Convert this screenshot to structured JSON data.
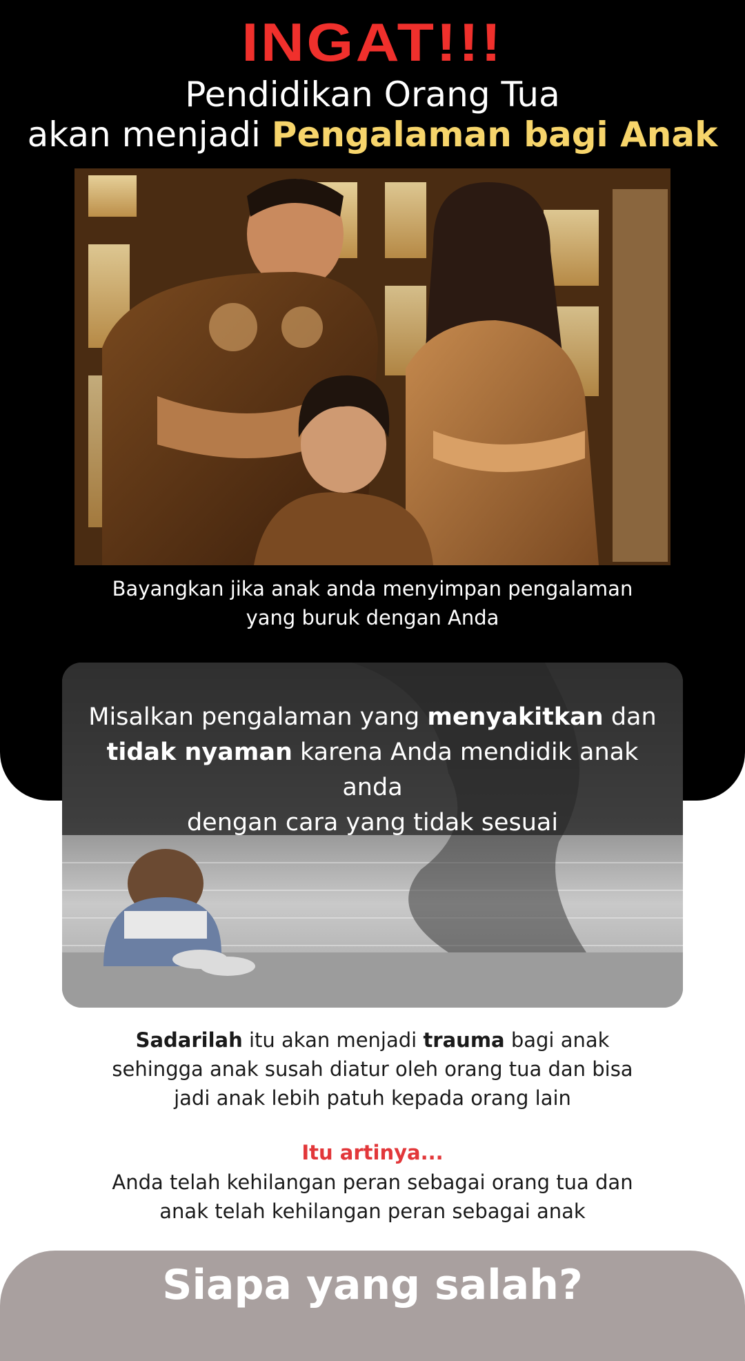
{
  "hero": {
    "title": "INGAT!!!",
    "headline_line1": "Pendidikan Orang Tua",
    "headline_line2_prefix": "akan menjadi ",
    "headline_line2_highlight": "Pengalaman bagi Anak",
    "caption_line1": "Bayangkan jika anak anda menyimpan pengalaman",
    "caption_line2": "yang buruk dengan Anda"
  },
  "card": {
    "t1": "Misalkan pengalaman yang ",
    "b1": "menyakitkan",
    "t2": " dan",
    "b2": "tidak nyaman",
    "t3": " karena Anda mendidik anak anda",
    "t4": "dengan cara yang tidak sesuai"
  },
  "para1": {
    "b1": "Sadarilah",
    "t1": " itu akan menjadi ",
    "b2": "trauma",
    "t2": " bagi anak",
    "line2": "sehingga anak susah diatur oleh orang tua dan bisa",
    "line3": "jadi anak lebih patuh kepada orang lain"
  },
  "artinya": "Itu artinya...",
  "para2": {
    "line1": "Anda telah kehilangan peran sebagai orang tua dan",
    "line2": "anak telah  kehilangan peran sebagai anak"
  },
  "bottom": {
    "label": "Siapa yang salah?"
  },
  "colors": {
    "accent_red": "#f0302c",
    "highlight_yellow": "#f7d56b",
    "bottom_bar": "#a9a09f"
  }
}
